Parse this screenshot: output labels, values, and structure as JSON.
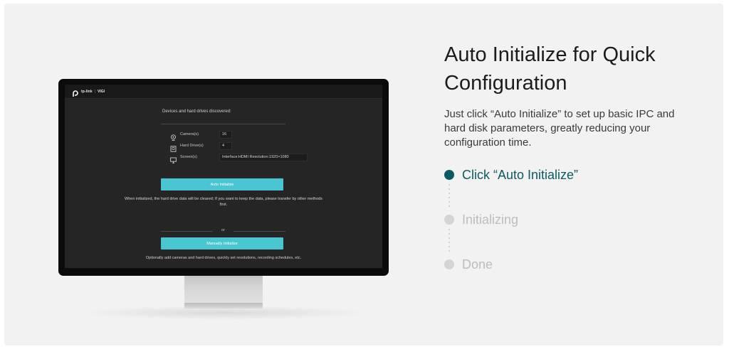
{
  "monitor_ui": {
    "logo": {
      "brand": "tp-link",
      "product": "VIGI"
    },
    "discovered_label": "Devices and hard drives discovered:",
    "rows": [
      {
        "label": "Camera(s)",
        "value": "16",
        "icon": "camera-icon"
      },
      {
        "label": "Hard Drive(s)",
        "value": "4",
        "icon": "hard-drive-icon"
      },
      {
        "label": "Screen(s)",
        "value": "Interface:HDMI Resolution:1920×1080",
        "icon": "monitor-icon"
      }
    ],
    "auto_button": "Auto Initialize",
    "warning": "When initialized, the hard drive data will be cleared; If you want to keep the data, please transfer by other methods first.",
    "or_text": "or",
    "manual_button": "Manually Initialize",
    "optional_text": "Optionally add cameras and hard drives, quickly set resolutions, recording schedules, etc."
  },
  "heading": "Auto Initialize for Quick Configuration",
  "description": "Just click “Auto Initialize” to set up basic IPC and hard disk parameters, greatly reducing your configuration time.",
  "steps": [
    {
      "label": "Click “Auto Initialize”",
      "active": true
    },
    {
      "label": "Initializing",
      "active": false
    },
    {
      "label": "Done",
      "active": false
    }
  ],
  "colors": {
    "active_step": "#0a5a63",
    "inactive_step": "#c4c4c4",
    "accent_button": "#4ac6d2"
  }
}
